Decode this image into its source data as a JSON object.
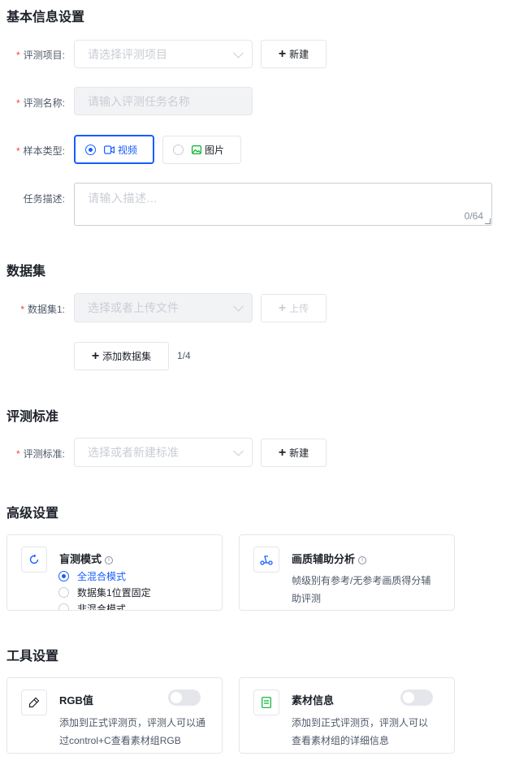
{
  "basic": {
    "title": "基本信息设置",
    "project_label": "评测项目:",
    "project_placeholder": "请选择评测项目",
    "new_label": "新建",
    "name_label": "评测名称:",
    "name_placeholder": "请输入评测任务名称",
    "sample_label": "样本类型:",
    "sample_video": "视频",
    "sample_image": "图片",
    "desc_label": "任务描述:",
    "desc_placeholder": "请输入描述...",
    "desc_count": "0/64"
  },
  "dataset": {
    "title": "数据集",
    "label": "数据集1:",
    "placeholder": "选择或者上传文件",
    "upload_label": "上传",
    "add_label": "添加数据集",
    "count": "1/4"
  },
  "standard": {
    "title": "评测标准",
    "label": "评测标准:",
    "placeholder": "选择或者新建标准",
    "new_label": "新建"
  },
  "advanced": {
    "title": "高级设置",
    "blind": {
      "title": "盲测模式",
      "options": [
        "全混合模式",
        "数据集1位置固定",
        "非混合模式"
      ]
    },
    "quality": {
      "title": "画质辅助分析",
      "desc": "帧级别有参考/无参考画质得分辅助评测"
    }
  },
  "tools": {
    "title": "工具设置",
    "rgb": {
      "title": "RGB值",
      "desc": "添加到正式评测页，评测人可以通过control+C查看素材组RGB"
    },
    "material": {
      "title": "素材信息",
      "desc": "添加到正式评测页，评测人可以查看素材组的详细信息"
    }
  },
  "colors": {
    "accent": "#165dff",
    "required": "#f53f3f",
    "border": "#e5e6eb"
  }
}
